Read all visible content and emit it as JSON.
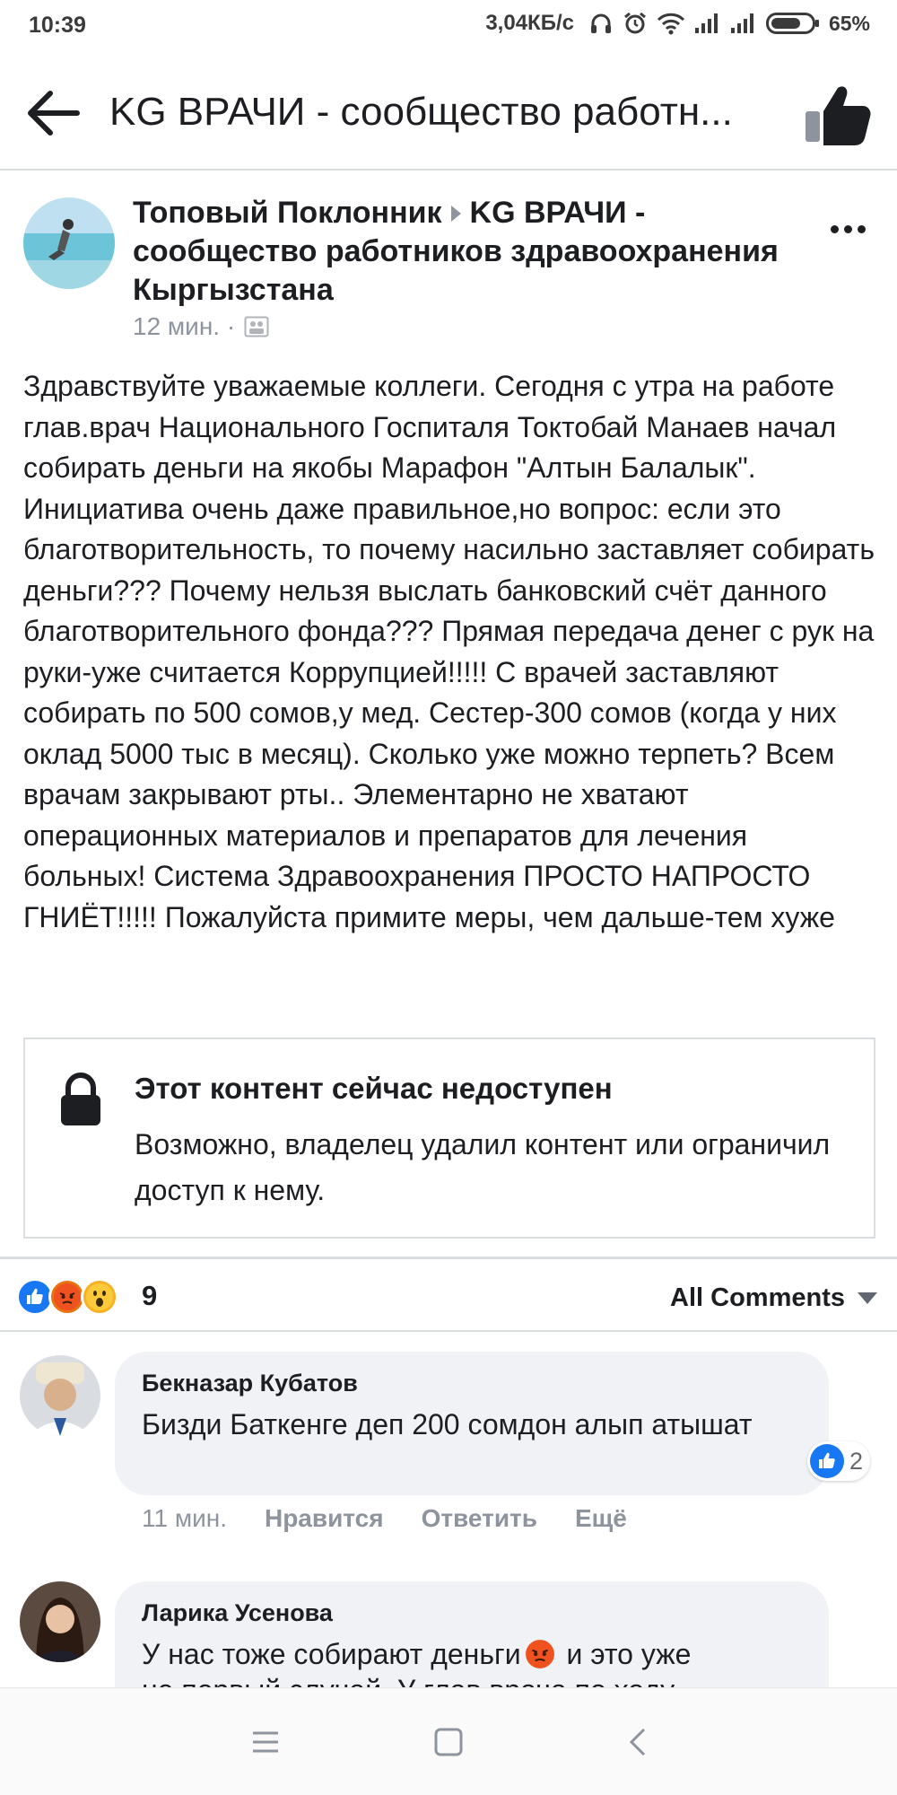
{
  "status_bar": {
    "time": "10:39",
    "network_speed": "3,04КБ/с",
    "battery_percent": "65%"
  },
  "header": {
    "title": "KG ВРАЧИ - сообщество работн..."
  },
  "post": {
    "author": "Топовый Поклонник",
    "group": "KG ВРАЧИ - сообщество работников здравоохранения Кыргызстана",
    "time": "12 мин. ·",
    "text": "Здравствуйте уважаемые коллеги. Сегодня с утра на работе глав.врач Национального Госпиталя Токтобай Манаев начал собирать деньги на якобы Марафон \"Алтын Балалык\". Инициатива очень даже правильное,но вопрос: если это благотворительность, то почему насильно заставляет собирать деньги??? Почему нельзя выслать банковский счёт данного благотворительного фонда??? Прямая передача денег с рук на руки-уже считается Коррупцией!!!!! С врачей заставляют собирать по 500 сомов,у мед. Сестер-300 сомов (когда у них оклад 5000 тыс в месяц). Сколько уже можно терпеть? Всем врачам закрывают рты.. Элементарно не хватают операционных материалов и препаратов для лечения больных! Система Здравоохранения ПРОСТО НАПРОСТО ГНИЁТ!!!!! Пожалуйста примите меры, чем дальше-тем хуже",
    "unavailable": {
      "title": "Этот контент сейчас недоступен",
      "description": "Возможно, владелец удалил контент или ограничил доступ к нему."
    },
    "reactions": {
      "count": "9",
      "types": [
        "like-icon",
        "angry-icon",
        "wow-icon"
      ]
    },
    "comments_filter": "All Comments"
  },
  "comments": [
    {
      "name": "Бекназар Кубатов",
      "text": "Бизди Баткенге деп 200 сомдон алып атышат",
      "likes": "2",
      "time": "11 мин.",
      "like_label": "Нравится",
      "reply_label": "Ответить",
      "more_label": "Ещё"
    },
    {
      "name": "Ларика Усенова",
      "text_before_emoji": "У нас тоже собирают деньги",
      "text_after_emoji": " и это уже",
      "text_cut": "не первый случай. У глав врача по ходу"
    }
  ],
  "colors": {
    "like_blue": "#1877f2",
    "text": "#1c1e21",
    "muted": "#8d949e",
    "bubble": "#f0f2f5"
  }
}
